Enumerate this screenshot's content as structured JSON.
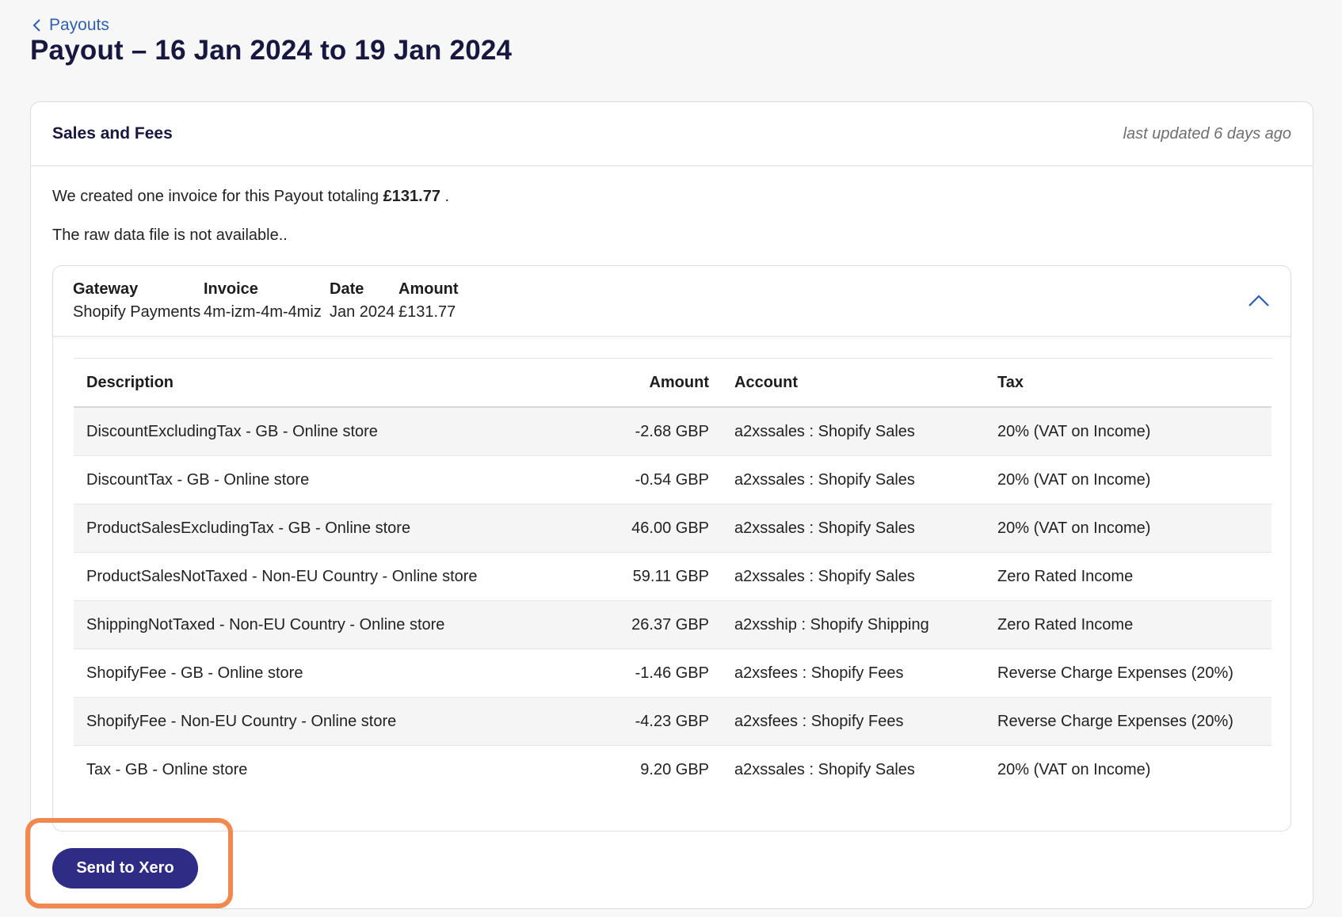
{
  "breadcrumb": {
    "label": "Payouts"
  },
  "page": {
    "title": "Payout – 16 Jan 2024 to 19 Jan 2024"
  },
  "card": {
    "title": "Sales and Fees",
    "last_updated": "last updated 6 days ago",
    "intro_prefix": "We created one invoice for this Payout totaling ",
    "intro_total": "£131.77",
    "intro_suffix": " .",
    "raw_data_note": "The raw data file is not available.."
  },
  "invoice": {
    "headers": {
      "gateway": "Gateway",
      "invoice": "Invoice",
      "date": "Date",
      "amount": "Amount"
    },
    "values": {
      "gateway": "Shopify Payments",
      "invoice": "4m-izm-4m-4miz",
      "date": "Jan 2024",
      "amount": "£131.77"
    },
    "expanded": true
  },
  "line_items": {
    "columns": {
      "description": "Description",
      "amount": "Amount",
      "account": "Account",
      "tax": "Tax"
    },
    "rows": [
      {
        "description": "DiscountExcludingTax - GB - Online store",
        "amount": "-2.68 GBP",
        "account": "a2xssales : Shopify Sales",
        "tax": "20% (VAT on Income)"
      },
      {
        "description": "DiscountTax - GB - Online store",
        "amount": "-0.54 GBP",
        "account": "a2xssales : Shopify Sales",
        "tax": "20% (VAT on Income)"
      },
      {
        "description": "ProductSalesExcludingTax - GB - Online store",
        "amount": "46.00 GBP",
        "account": "a2xssales : Shopify Sales",
        "tax": "20% (VAT on Income)"
      },
      {
        "description": "ProductSalesNotTaxed - Non-EU Country - Online store",
        "amount": "59.11 GBP",
        "account": "a2xssales : Shopify Sales",
        "tax": "Zero Rated Income"
      },
      {
        "description": "ShippingNotTaxed - Non-EU Country - Online store",
        "amount": "26.37 GBP",
        "account": "a2xsship : Shopify Shipping",
        "tax": "Zero Rated Income"
      },
      {
        "description": "ShopifyFee - GB - Online store",
        "amount": "-1.46 GBP",
        "account": "a2xsfees : Shopify Fees",
        "tax": "Reverse Charge Expenses (20%)"
      },
      {
        "description": "ShopifyFee - Non-EU Country - Online store",
        "amount": "-4.23 GBP",
        "account": "a2xsfees : Shopify Fees",
        "tax": "Reverse Charge Expenses (20%)"
      },
      {
        "description": "Tax - GB - Online store",
        "amount": "9.20 GBP",
        "account": "a2xssales : Shopify Sales",
        "tax": "20% (VAT on Income)"
      }
    ]
  },
  "actions": {
    "send_label": "Send to Xero"
  },
  "colors": {
    "brand_navy": "#2e2c85",
    "link_blue": "#2f5fad",
    "highlight_orange": "#f0884f"
  },
  "icons": {
    "back": "chevron-left-icon",
    "collapse": "chevron-up-icon"
  }
}
